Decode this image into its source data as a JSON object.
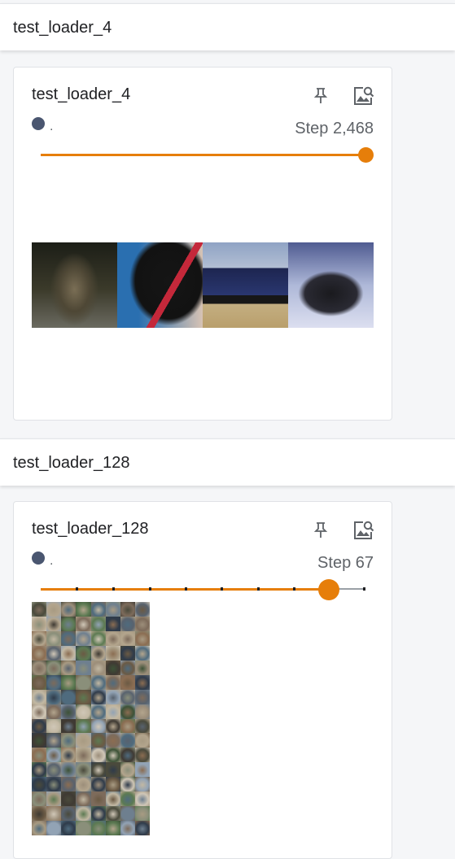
{
  "sections": [
    {
      "header": "test_loader_4",
      "card": {
        "title": "test_loader_4",
        "run_name": ".",
        "step_label": "Step 2,468",
        "slider_fraction": 1.0,
        "images": [
          {
            "name": "dog-on-table",
            "colors": [
              "#3b3a2a",
              "#6b6348",
              "#1d1f16"
            ]
          },
          {
            "name": "black-dog-red-collar",
            "colors": [
              "#2a6fb0",
              "#121212",
              "#c4283a"
            ]
          },
          {
            "name": "blue-truck",
            "colors": [
              "#1d2550",
              "#c8b58a",
              "#8fa3c4"
            ]
          },
          {
            "name": "black-cat",
            "colors": [
              "#aeb8d8",
              "#1a1a1e",
              "#dcdff0"
            ]
          }
        ]
      }
    },
    {
      "header": "test_loader_128",
      "card": {
        "title": "test_loader_128",
        "run_name": ".",
        "step_label": "Step 67",
        "slider_fraction": 0.89,
        "grid": {
          "columns": 8,
          "rows": 16
        }
      }
    }
  ],
  "icons": {
    "pin": "pin-icon",
    "image_search": "image-search-icon"
  },
  "colors": {
    "accent": "#e67e0a",
    "run_dot": "#4a5670"
  }
}
